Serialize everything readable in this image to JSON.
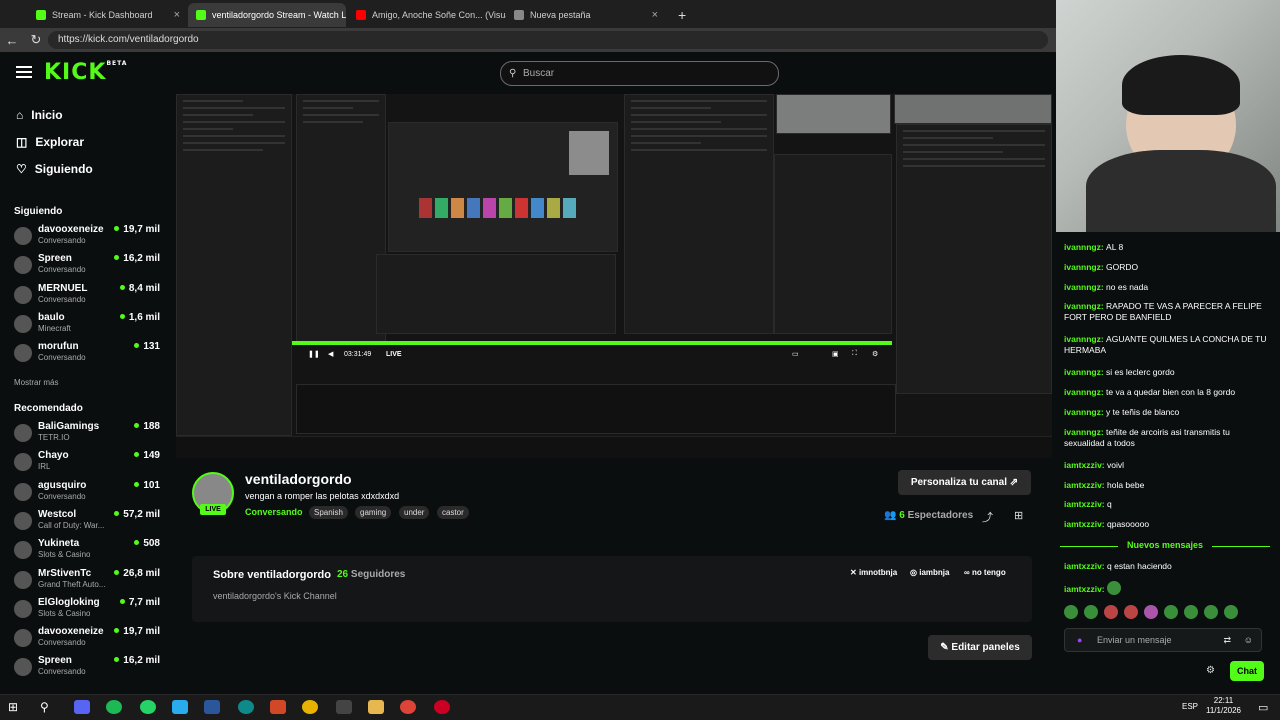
{
  "browser": {
    "tabs": [
      {
        "label": "Stream - Kick Dashboard",
        "color": "#53fc18"
      },
      {
        "label": "ventiladorgordo Stream - Watch L",
        "color": "#53fc18",
        "active": true
      },
      {
        "label": "Amigo, Anoche Soñe Con... (Visual",
        "color": "#ff0000"
      },
      {
        "label": "Nueva pestaña",
        "color": "#888888"
      }
    ],
    "url": "https://kick.com/ventiladorgordo"
  },
  "header": {
    "logo": "KICK",
    "logo_sup": "BETA",
    "search_placeholder": "Buscar"
  },
  "sidebar": {
    "nav": [
      {
        "label": "Inicio",
        "icon": "home-icon"
      },
      {
        "label": "Explorar",
        "icon": "compass-icon"
      },
      {
        "label": "Siguiendo",
        "icon": "heart-icon"
      }
    ],
    "following_title": "Siguiendo",
    "following": [
      {
        "name": "davooxeneize",
        "category": "Conversando",
        "viewers": "19,7 mil"
      },
      {
        "name": "Spreen",
        "category": "Conversando",
        "viewers": "16,2 mil"
      },
      {
        "name": "MERNUEL",
        "category": "Conversando",
        "viewers": "8,4 mil"
      },
      {
        "name": "baulo",
        "category": "Minecraft",
        "viewers": "1,6 mil"
      },
      {
        "name": "morufun",
        "category": "Conversando",
        "viewers": "131"
      }
    ],
    "show_more": "Mostrar más",
    "recommended_title": "Recomendado",
    "recommended": [
      {
        "name": "BaliGamings",
        "category": "TETR.IO",
        "viewers": "188"
      },
      {
        "name": "Chayo",
        "category": "IRL",
        "viewers": "149"
      },
      {
        "name": "agusquiro",
        "category": "Conversando",
        "viewers": "101"
      },
      {
        "name": "Westcol",
        "category": "Call of Duty: War...",
        "viewers": "57,2 mil"
      },
      {
        "name": "Yukineta",
        "category": "Slots & Casino",
        "viewers": "508"
      },
      {
        "name": "MrStivenTc",
        "category": "Grand Theft Auto...",
        "viewers": "26,8 mil"
      },
      {
        "name": "ElGlogloking",
        "category": "Slots & Casino",
        "viewers": "7,7 mil"
      },
      {
        "name": "davooxeneize",
        "category": "Conversando",
        "viewers": "19,7 mil"
      },
      {
        "name": "Spreen",
        "category": "Conversando",
        "viewers": "16,2 mil"
      }
    ]
  },
  "player": {
    "time": "03:31:49",
    "live": "LIVE"
  },
  "channel": {
    "name": "ventiladorgordo",
    "title": "vengan a romper las pelotas xdxdxdxd",
    "category": "Conversando",
    "tags": [
      "Spanish",
      "gaming",
      "under",
      "castor"
    ],
    "live_badge": "LIVE",
    "customize_button": "Personaliza tu canal",
    "viewers_count": "6",
    "viewers_label": "Espectadores"
  },
  "about": {
    "title": "Sobre ventiladorgordo",
    "followers_count": "26",
    "followers_label": "Seguidores",
    "description": "ventiladorgordo's Kick Channel",
    "socials": [
      "imnotbnja",
      "iambnja",
      "no tengo"
    ],
    "edit_button": "Editar paneles"
  },
  "chat": {
    "messages": [
      {
        "user": "ivannngz",
        "text": "AL 8"
      },
      {
        "user": "ivannngz",
        "text": "GORDO"
      },
      {
        "user": "ivannngz",
        "text": "no es nada"
      },
      {
        "user": "ivannngz",
        "text": "RAPADO TE VAS A PARECER A FELIPE FORT PERO DE BANFIELD"
      },
      {
        "user": "ivannngz",
        "text": "AGUANTE QUILMES LA CONCHA DE TU HERMABA"
      },
      {
        "user": "ivannngz",
        "text": "si es leclerc gordo"
      },
      {
        "user": "ivannngz",
        "text": "te va a quedar bien con la 8 gordo"
      },
      {
        "user": "ivannngz",
        "text": "y te teñis de blanco"
      },
      {
        "user": "ivannngz",
        "text": "teñite de arcoiris asi transmitis tu sexualidad a todos"
      },
      {
        "user": "iamtxzziv",
        "text": "voivl"
      },
      {
        "user": "iamtxzziv",
        "text": "hola bebe"
      },
      {
        "user": "iamtxzziv",
        "text": "q"
      },
      {
        "user": "iamtxzziv",
        "text": "qpasooooo"
      }
    ],
    "new_messages": "Nuevos mensajes",
    "after_messages": [
      {
        "user": "iamtxzziv",
        "text": "q estan haciendo"
      },
      {
        "user": "iamtxzziv",
        "text": ""
      }
    ],
    "input_placeholder": "Enviar un mensaje",
    "send_button": "Chat"
  },
  "taskbar": {
    "lang": "ESP",
    "time": "22:11",
    "date": "11/1/2026"
  }
}
